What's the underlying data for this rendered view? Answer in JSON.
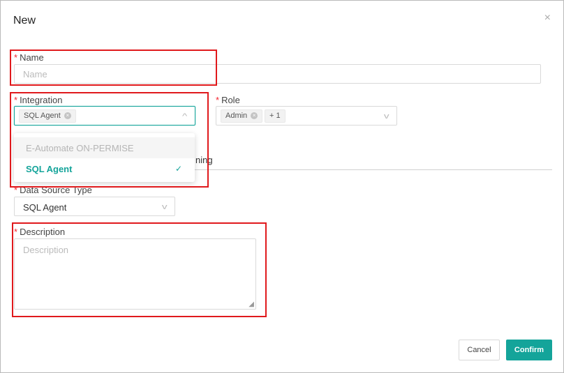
{
  "dialog": {
    "title": "New",
    "close_glyph": "×"
  },
  "name": {
    "required_mark": "*",
    "label": "Name",
    "placeholder": "Name"
  },
  "integration": {
    "required_mark": "*",
    "label": "Integration",
    "selected_tag": "SQL Agent",
    "arrow_glyph": "^",
    "options": [
      {
        "label": "E-Automate ON-PERMISE",
        "state": "disabled"
      },
      {
        "label": "SQL Agent",
        "state": "selected"
      }
    ],
    "check_glyph": "✓"
  },
  "role": {
    "required_mark": "*",
    "label": "Role",
    "selected_tag": "Admin",
    "more_tag": "+ 1",
    "arrow_glyph": "v"
  },
  "tab_peek_text": "ning",
  "data_source": {
    "required_mark": "*",
    "label": "Data Source Type",
    "value": "SQL Agent",
    "arrow_glyph": "v"
  },
  "description": {
    "required_mark": "*",
    "label": "Description",
    "placeholder": "Description",
    "resize_glyph": "◢"
  },
  "buttons": {
    "cancel": "Cancel",
    "confirm": "Confirm"
  },
  "colors": {
    "accent": "#14a49a",
    "required": "#f5222d",
    "highlight": "#e0191c"
  }
}
